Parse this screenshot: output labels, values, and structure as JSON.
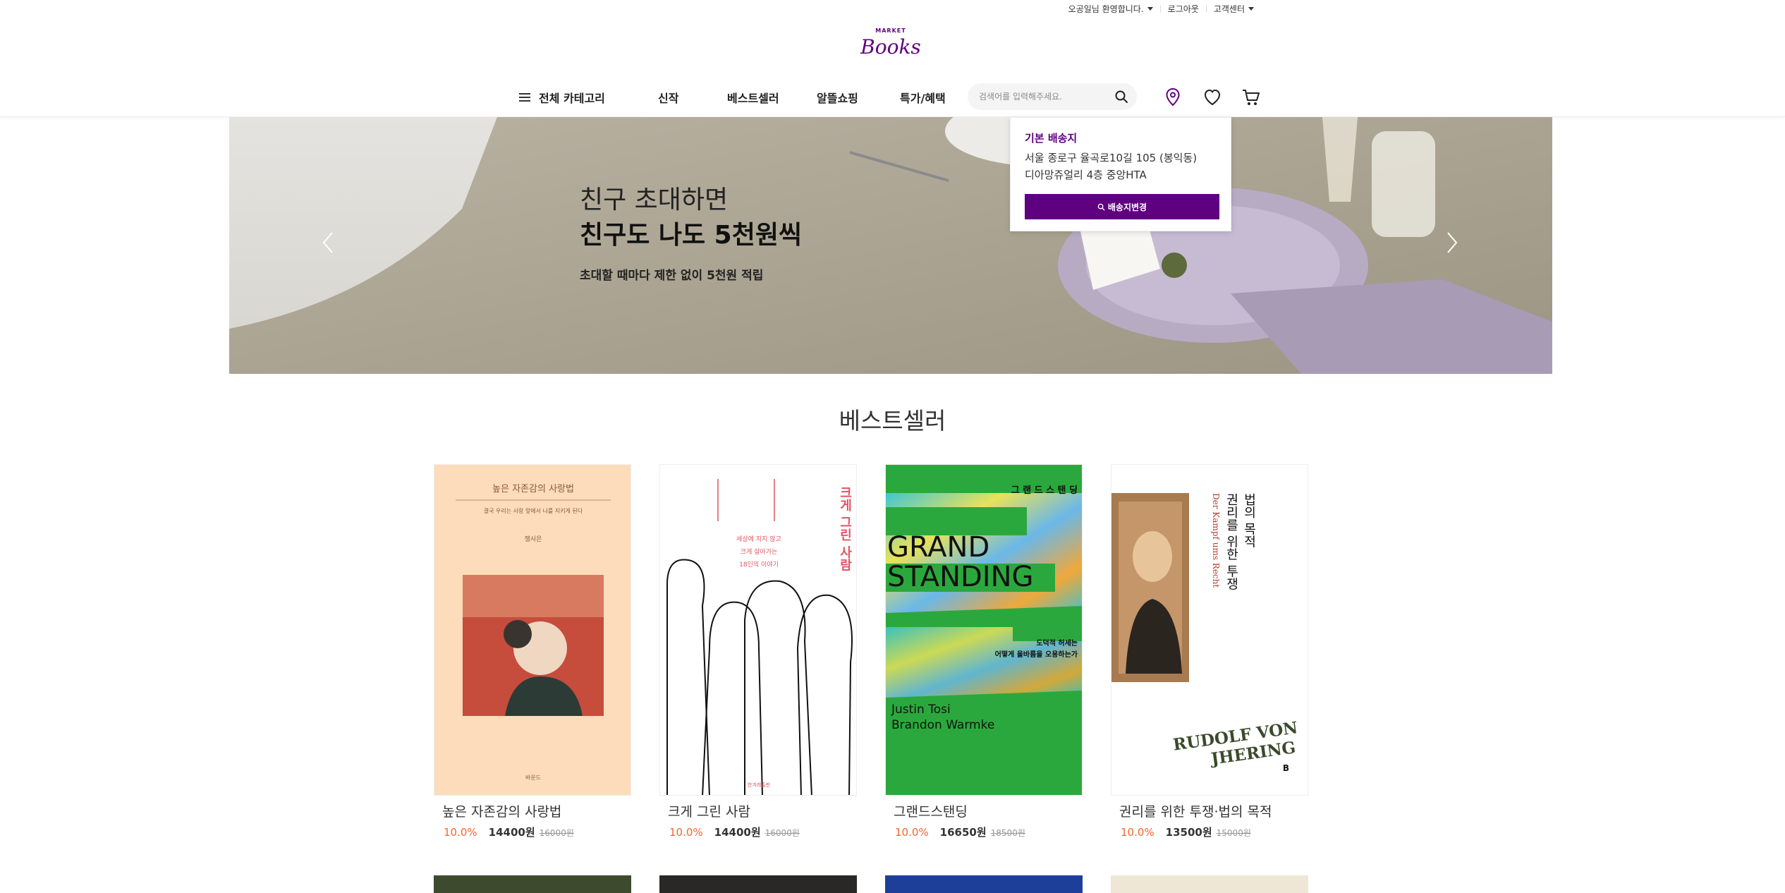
{
  "util": {
    "welcome": "오공일님 환영합니다.",
    "logout": "로그아웃",
    "service": "고객센터"
  },
  "logo": {
    "top_text": "MARKET",
    "main_text": "Books"
  },
  "nav": {
    "category": "전체 카테고리",
    "items": [
      "신작",
      "베스트셀러",
      "알뜰쇼핑",
      "특가/혜택"
    ],
    "search_placeholder": "검색어를 입력해주세요."
  },
  "banner": {
    "line1": "친구 초대하면",
    "line2": "친구도 나도 5천원씩",
    "sub": "초대할 때마다 제한 없이 5천원 적립"
  },
  "delivery_popup": {
    "title": "기본 배송지",
    "address_line1": "서울 종로구 율곡로10길 105 (봉익동)",
    "address_line2": "디아망쥬얼리 4층 중앙HTA",
    "button": "배송지변경"
  },
  "bestseller": {
    "title": "베스트셀러",
    "books": [
      {
        "title": "높은 자존감의 사랑법",
        "discount": "10.0%",
        "price": "14400원",
        "original": "16000원",
        "cover": {
          "top": "높은 자존감의 사랑법",
          "sub": "결국 우리는 사랑 앞에서 나를 지키게 된다",
          "author": "쟁사은",
          "publisher": "바운드"
        }
      },
      {
        "title": "크게 그린 사람",
        "discount": "10.0%",
        "price": "14400원",
        "original": "16000원",
        "cover": {
          "vtitle": "크게 그린 사람",
          "sub1": "세상에 지지 않고",
          "sub2": "크게 살아가는",
          "sub3": "18인의 이야기",
          "publisher": "한겨레출판"
        }
      },
      {
        "title": "그랜드스탠딩",
        "discount": "10.0%",
        "price": "16650원",
        "original": "18500원",
        "cover": {
          "kor": "그 랜 드 스 탠 딩",
          "eng1": "GRAND",
          "eng2": "STANDING",
          "sub1": "도덕적 허세는",
          "sub2": "어떻게 올바름을 오용하는가",
          "author1": "Justin Tosi",
          "author2": "Brandon Warmke"
        }
      },
      {
        "title": "권리를 위한 투쟁·법의 목적",
        "discount": "10.0%",
        "price": "13500원",
        "original": "15000원",
        "cover": {
          "v1": "법의 목적",
          "v2": "권리를 위한 투쟁",
          "german": "Der Kampf ums Recht",
          "author1": "RUDOLF VON",
          "author2": "JHERING",
          "publisher": "B"
        }
      }
    ]
  },
  "colors": {
    "brand": "#5f0080",
    "discount": "#fa622f"
  }
}
